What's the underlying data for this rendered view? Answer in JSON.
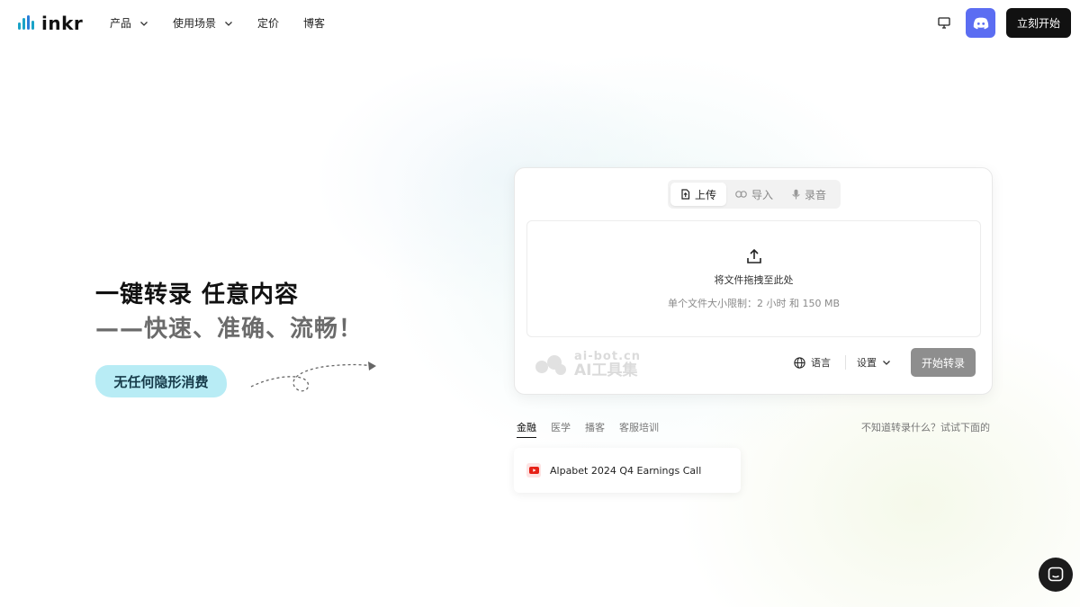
{
  "header": {
    "logo_text": "inkr",
    "nav": [
      {
        "label": "产品",
        "has_dropdown": true
      },
      {
        "label": "使用场景",
        "has_dropdown": true
      },
      {
        "label": "定价",
        "has_dropdown": false
      },
      {
        "label": "博客",
        "has_dropdown": false
      }
    ],
    "start_button": "立刻开始",
    "icons": [
      "monitor-icon",
      "discord-icon"
    ]
  },
  "hero": {
    "title": "一键转录 任意内容",
    "subtitle": "——快速、准确、流畅！",
    "badge": "无任何隐形消费"
  },
  "upload_card": {
    "tabs": [
      {
        "label": "上传",
        "icon": "file-upload-icon",
        "active": true
      },
      {
        "label": "导入",
        "icon": "link-icon",
        "active": false
      },
      {
        "label": "录音",
        "icon": "mic-icon",
        "active": false
      }
    ],
    "drop_text": "将文件拖拽至此处",
    "drop_hint": "单个文件大小限制：2 小时 和 150 MB",
    "language_label": "语言",
    "settings_label": "设置",
    "start_button": "开始转录",
    "watermark_top": "ai-bot.cn",
    "watermark_bottom": "AI工具集"
  },
  "categories": {
    "items": [
      {
        "label": "金融",
        "active": true
      },
      {
        "label": "医学",
        "active": false
      },
      {
        "label": "播客",
        "active": false
      },
      {
        "label": "客服培训",
        "active": false
      }
    ],
    "hint": "不知道转录什么？试试下面的"
  },
  "examples": [
    {
      "title": "Alpabet 2024 Q4 Earnings Call",
      "source_icon": "youtube-icon"
    }
  ],
  "colors": {
    "accent_cyan": "#1aa3c7",
    "discord": "#5b6df2",
    "badge_bg": "#b8ecf5",
    "button_dark": "#111111",
    "button_disabled": "#8e8e8e"
  }
}
